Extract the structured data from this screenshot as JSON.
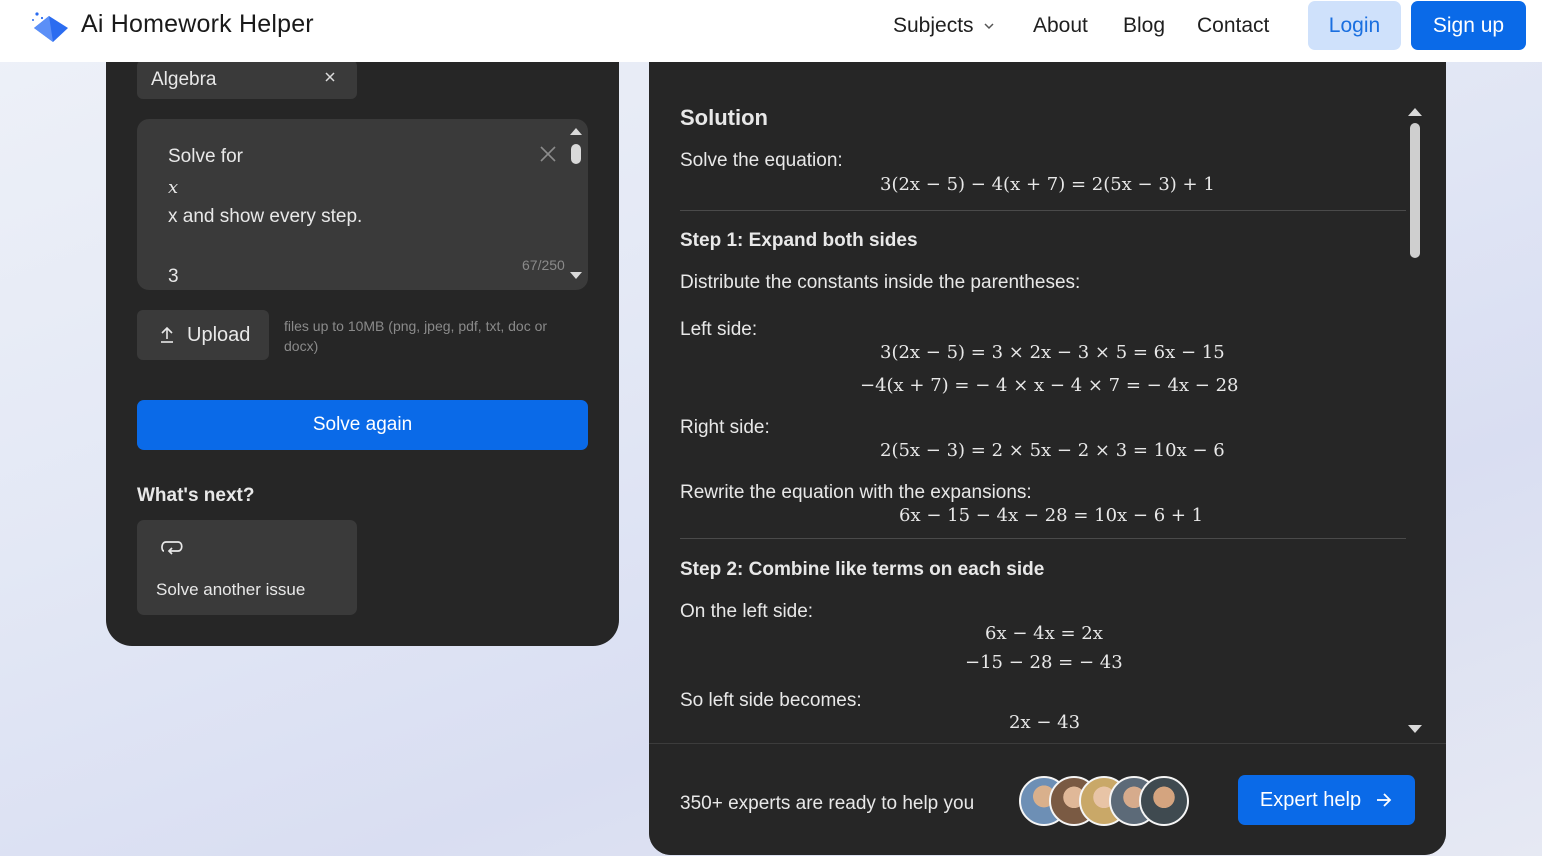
{
  "header": {
    "brand": "Ai Homework Helper",
    "nav": {
      "subjects": "Subjects",
      "about": "About",
      "blog": "Blog",
      "contact": "Contact"
    },
    "login": "Login",
    "signup": "Sign up"
  },
  "left": {
    "subject_chip": "Algebra",
    "textarea": {
      "line1": "Solve for",
      "line2": "x",
      "line3": "x and show every step.",
      "line4": "3",
      "count": "67/250"
    },
    "upload_label": "Upload",
    "upload_hint": "files up to 10MB (png, jpeg, pdf, txt, doc or docx)",
    "solve_again": "Solve again",
    "whats_next": "What's next?",
    "next_card": "Solve another issue"
  },
  "solution": {
    "title": "Solution",
    "intro": "Solve the equation:",
    "equation": "3(2x − 5) − 4(x + 7) = 2(5x − 3) + 1",
    "step1": {
      "title": "Step 1: Expand both sides",
      "desc": "Distribute the constants inside the parentheses:",
      "left_label": "Left side:",
      "left_eq1": "3(2x − 5) = 3 × 2x − 3 × 5 = 6x − 15",
      "left_eq2": "−4(x + 7) = − 4 × x − 4 × 7 = − 4x − 28",
      "right_label": "Right side:",
      "right_eq": "2(5x − 3) = 2 × 5x − 2 × 3 = 10x − 6",
      "rewrite_label": "Rewrite the equation with the expansions:",
      "rewrite_eq": "6x − 15 − 4x − 28 = 10x − 6 + 1"
    },
    "step2": {
      "title": "Step 2: Combine like terms on each side",
      "left_label": "On the left side:",
      "eq1": "6x − 4x = 2x",
      "eq2": "−15 − 28 = − 43",
      "becomes_label": "So left side becomes:",
      "becomes_eq": "2x − 43"
    }
  },
  "footer": {
    "experts_text": "350+ experts are ready to help you",
    "expert_button": "Expert help"
  },
  "colors": {
    "accent": "#0a6ae8",
    "panel": "#262626",
    "surface": "#3a3a3a"
  }
}
